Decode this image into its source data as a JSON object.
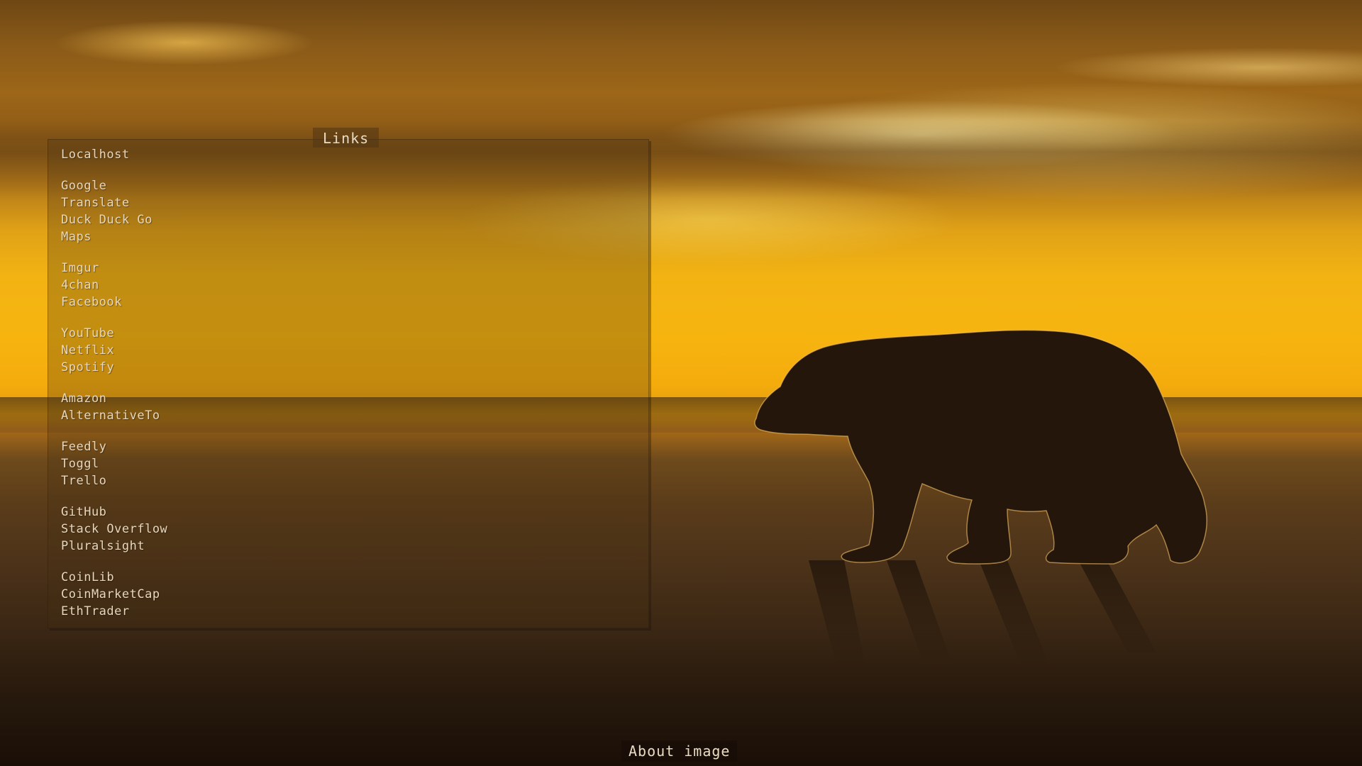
{
  "panel": {
    "title": "Links",
    "groups": [
      [
        "Localhost"
      ],
      [
        "Google",
        "Translate",
        "Duck Duck Go",
        "Maps"
      ],
      [
        "Imgur",
        "4chan",
        "Facebook"
      ],
      [
        "YouTube",
        "Netflix",
        "Spotify"
      ],
      [
        "Amazon",
        "AlternativeTo"
      ],
      [
        "Feedly",
        "Toggl",
        "Trello"
      ],
      [
        "GitHub",
        "Stack Overflow",
        "Pluralsight"
      ],
      [
        "CoinLib",
        "CoinMarketCap",
        "EthTrader"
      ]
    ]
  },
  "footer": {
    "about_label": "About image"
  },
  "colors": {
    "text": "#e6d7bd",
    "sky": "#f4ac0d",
    "ground": "#3b2714"
  }
}
